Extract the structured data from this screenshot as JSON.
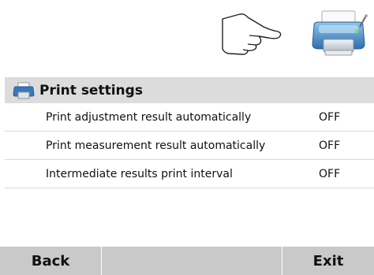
{
  "icons": {
    "hand": "pointing-hand-icon",
    "printer": "printer-icon"
  },
  "header": {
    "title": "Print settings",
    "icon": "printer-icon"
  },
  "settings": [
    {
      "label": "Print adjustment result automatically",
      "value": "OFF"
    },
    {
      "label": "Print measurement result automatically",
      "value": "OFF"
    },
    {
      "label": "Intermediate results print interval",
      "value": "OFF"
    }
  ],
  "footer": {
    "back_label": "Back",
    "exit_label": "Exit"
  },
  "colors": {
    "header_bg": "#dcdcdc",
    "footer_bg": "#c9c9c9",
    "printer_blue": "#3a78b8"
  }
}
